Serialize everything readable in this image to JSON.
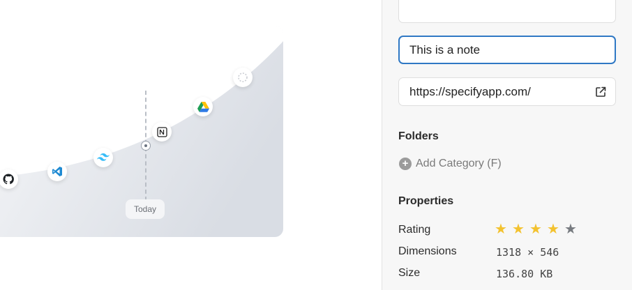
{
  "preview": {
    "today_label": "Today",
    "icons": [
      "github-icon",
      "vscode-icon",
      "tailwind-icon",
      "notion-icon",
      "google-drive-icon",
      "loading-spinner-icon"
    ]
  },
  "fields": {
    "top_value": "",
    "note_value": "This is a note",
    "url_value": "https://specifyapp.com/"
  },
  "folders": {
    "title": "Folders",
    "add_label": "Add Category (F)"
  },
  "properties": {
    "title": "Properties",
    "rating_label": "Rating",
    "rating": 4,
    "rating_max": 5,
    "dimensions_label": "Dimensions",
    "dimensions_value": "1318 × 546",
    "size_label": "Size",
    "size_value": "136.80 KB"
  },
  "colors": {
    "accent": "#2f78c4",
    "star_on": "#f3c22f",
    "star_off": "#777b80"
  }
}
